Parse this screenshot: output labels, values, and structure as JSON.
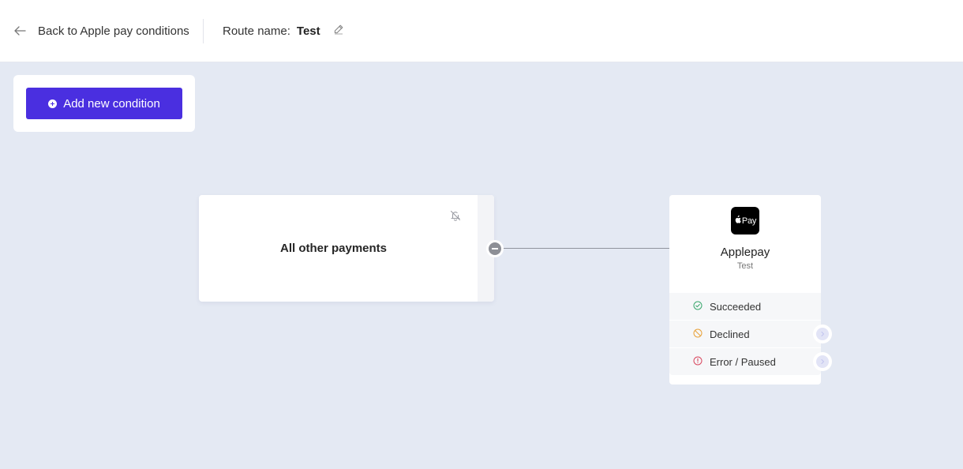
{
  "header": {
    "back_label": "Back to Apple pay conditions",
    "route_label": "Route name:",
    "route_value": "Test"
  },
  "toolbar": {
    "add_condition_label": "Add new condition"
  },
  "condition_node": {
    "title": "All other payments"
  },
  "provider_node": {
    "logo_text": "Pay",
    "name": "Applepay",
    "subtitle": "Test",
    "outcomes": [
      {
        "label": "Succeeded",
        "icon": "check-circle-icon",
        "color": "#3aa76d"
      },
      {
        "label": "Declined",
        "icon": "ban-circle-icon",
        "color": "#e8a23a"
      },
      {
        "label": "Error / Paused",
        "icon": "alert-circle-icon",
        "color": "#d9485f"
      }
    ]
  },
  "colors": {
    "accent": "#4a2fe0",
    "canvas_background": "#e4e9f3"
  }
}
